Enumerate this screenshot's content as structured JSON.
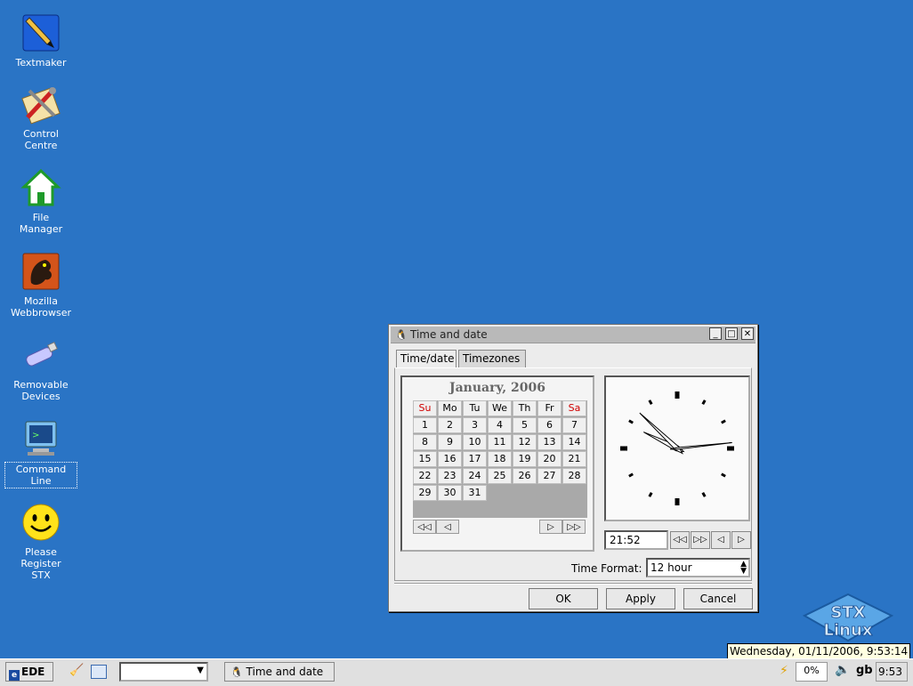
{
  "desktop": {
    "icons": [
      {
        "label_lines": [
          "Textmaker"
        ]
      },
      {
        "label_lines": [
          "Control",
          "Centre"
        ]
      },
      {
        "label_lines": [
          "File",
          "Manager"
        ]
      },
      {
        "label_lines": [
          "Mozilla",
          "Webbrowser"
        ]
      },
      {
        "label_lines": [
          "Removable",
          "Devices"
        ]
      },
      {
        "label_lines": [
          "Command",
          "Line"
        ]
      },
      {
        "label_lines": [
          "Please",
          "Register",
          "STX"
        ]
      }
    ],
    "logo_text": [
      "STX",
      "Linux"
    ]
  },
  "window": {
    "title": "Time and date",
    "tabs": [
      "Time/date",
      "Timezones"
    ],
    "calendar": {
      "title": "January, 2006",
      "weekdays": [
        "Su",
        "Mo",
        "Tu",
        "We",
        "Th",
        "Fr",
        "Sa"
      ],
      "days": [
        "1",
        "2",
        "3",
        "4",
        "5",
        "6",
        "7",
        "8",
        "9",
        "10",
        "11",
        "12",
        "13",
        "14",
        "15",
        "16",
        "17",
        "18",
        "19",
        "20",
        "21",
        "22",
        "23",
        "24",
        "25",
        "26",
        "27",
        "28",
        "29",
        "30",
        "31"
      ],
      "first_weekday_index": 0,
      "nav": [
        "⏪",
        "◁",
        "▷",
        "⏩"
      ]
    },
    "clock": {
      "hours": 21,
      "minutes": 52,
      "seconds": 14
    },
    "time_value": "21:52",
    "time_buttons": [
      "◁◁",
      "▷▷",
      "◁",
      "▷"
    ],
    "time_format_label": "Time Format:",
    "time_format_value": "12 hour",
    "buttons": {
      "ok": "OK",
      "apply": "Apply",
      "cancel": "Cancel"
    }
  },
  "taskbar": {
    "start_label": "EDE",
    "task_label": "Time and date",
    "cpu": "0%",
    "keyboard": "gb",
    "clock": "9:53",
    "tooltip": "Wednesday, 01/11/2006, 9:53:14"
  },
  "colors": {
    "desktop": "#2a74c5",
    "weekend": "#d00000"
  }
}
